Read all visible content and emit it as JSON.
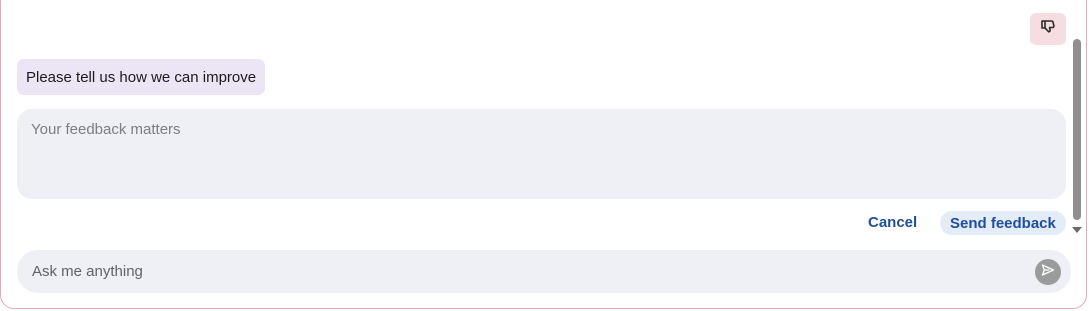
{
  "feedback": {
    "prompt_message": "Please tell us how we can improve",
    "textarea_placeholder": "Your feedback matters",
    "cancel_label": "Cancel",
    "send_label": "Send feedback",
    "thumbs_down_icon": "thumbs-down-icon"
  },
  "composer": {
    "placeholder": "Ask me anything",
    "send_icon": "send-arrow-icon"
  },
  "colors": {
    "accent_text": "#1f4f9c",
    "frame_border": "#e3a9b6",
    "thumbs_button_bg": "#f5dde2",
    "bubble_bg": "#ebe5f6",
    "input_bg": "#eef0f6"
  }
}
